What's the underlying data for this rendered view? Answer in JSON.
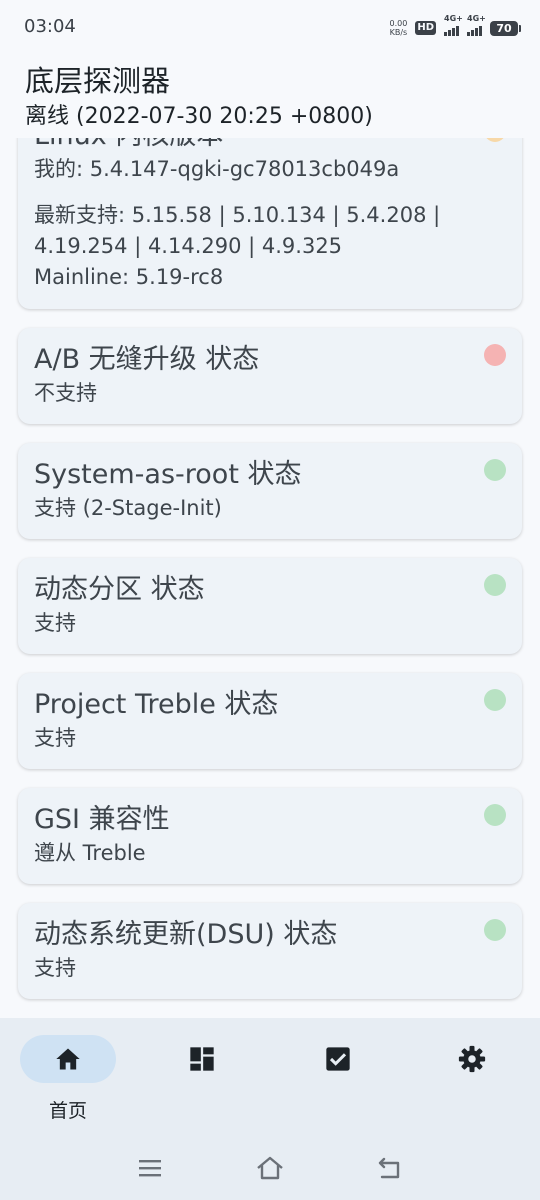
{
  "status_bar": {
    "time": "03:04",
    "net_speed_value": "0.00",
    "net_speed_unit": "KB/s",
    "hd_label": "HD",
    "sim1_label": "4G+",
    "sim2_label": "4G+",
    "battery_level": "70"
  },
  "header": {
    "title": "底层探测器",
    "subtitle": "离线 (2022-07-30 20:25 +0800)"
  },
  "cards": [
    {
      "title": "Linux 内核版本",
      "value": "我的: 5.4.147-qgki-gc78013cb049a",
      "detail": "最新支持: 5.15.58 | 5.10.134 | 5.4.208 |\n4.19.254 | 4.14.290 | 4.9.325\nMainline: 5.19-rc8",
      "status": "warning"
    },
    {
      "title": "A/B 无缝升级 状态",
      "value": "不支持",
      "status": "error"
    },
    {
      "title": "System-as-root 状态",
      "value": "支持 (2-Stage-Init)",
      "status": "ok"
    },
    {
      "title": "动态分区 状态",
      "value": "支持",
      "status": "ok"
    },
    {
      "title": "Project Treble 状态",
      "value": "支持",
      "status": "ok"
    },
    {
      "title": "GSI 兼容性",
      "value": "遵从 Treble",
      "status": "ok"
    },
    {
      "title": "动态系统更新(DSU) 状态",
      "value": "支持",
      "status": "ok"
    }
  ],
  "status_colors": {
    "warning": "#f7d8a8",
    "error": "#f5b3b3",
    "ok": "#b8e2c3"
  },
  "bottom_nav": {
    "items": [
      {
        "icon": "home-icon",
        "label": "首页",
        "active": true
      },
      {
        "icon": "dashboard-icon",
        "label": "",
        "active": false
      },
      {
        "icon": "checkbox-icon",
        "label": "",
        "active": false
      },
      {
        "icon": "gear-icon",
        "label": "",
        "active": false
      }
    ]
  },
  "system_nav": [
    "menu-icon",
    "home-outline-icon",
    "back-icon"
  ]
}
